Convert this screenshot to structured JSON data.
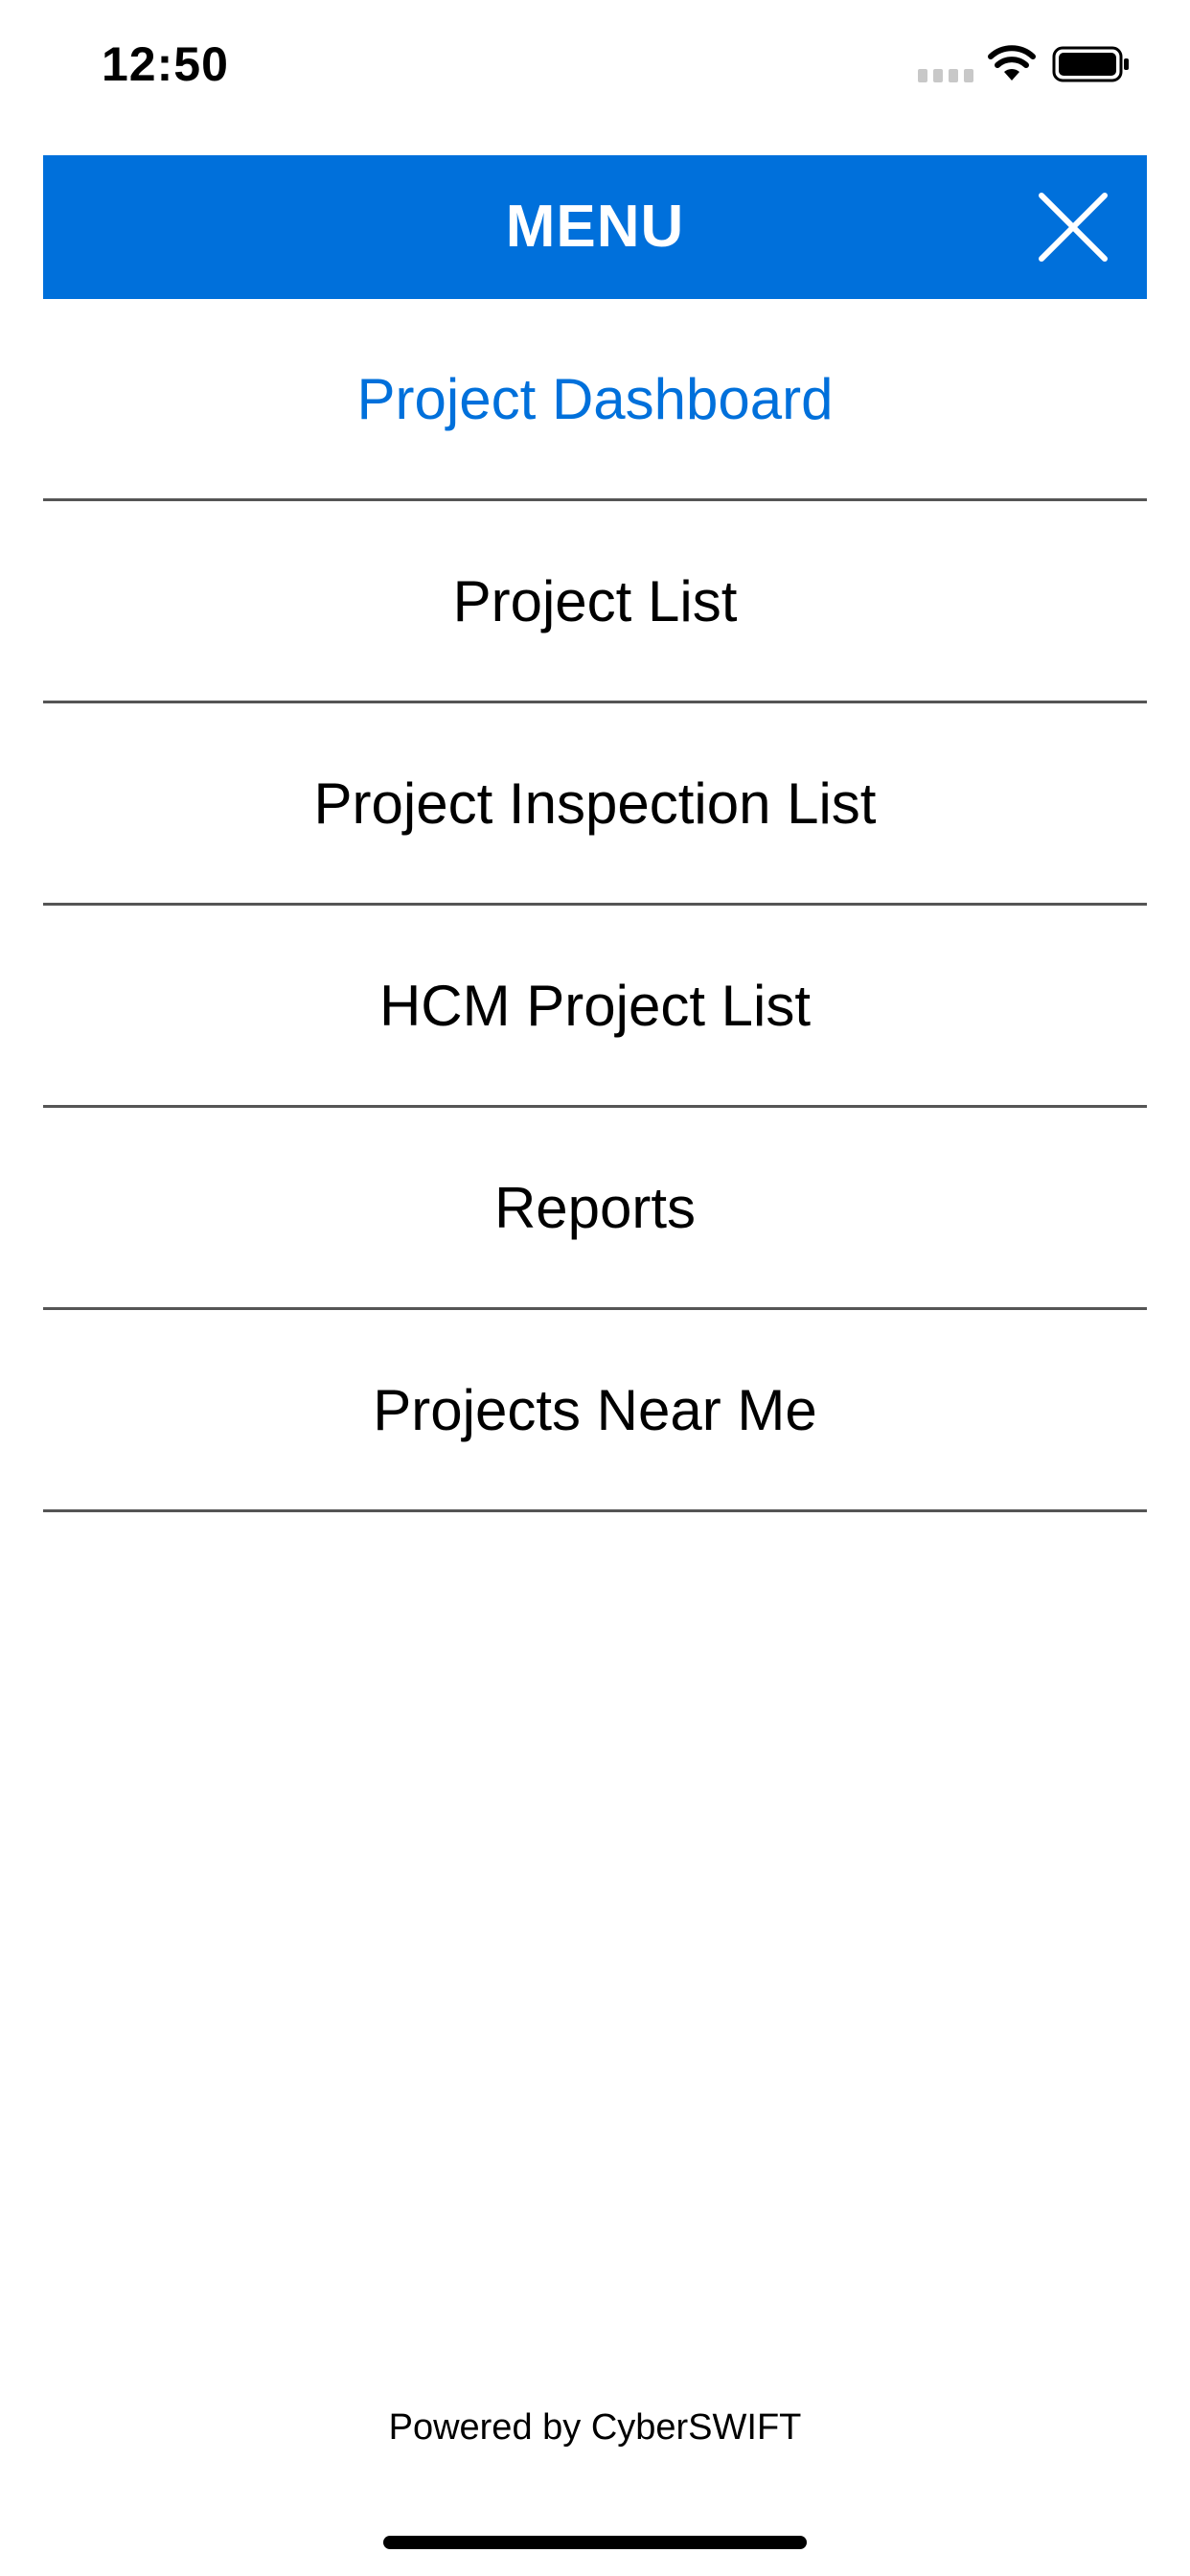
{
  "status_bar": {
    "time": "12:50",
    "icons": [
      "signal-icon",
      "wifi-icon",
      "battery-icon"
    ]
  },
  "header": {
    "title": "MENU",
    "close_icon": "close-icon",
    "background_color": "#0070db"
  },
  "menu": {
    "items": [
      {
        "label": "Project Dashboard",
        "active": true
      },
      {
        "label": "Project List",
        "active": false
      },
      {
        "label": "Project Inspection List",
        "active": false
      },
      {
        "label": "HCM Project List",
        "active": false
      },
      {
        "label": "Reports",
        "active": false
      },
      {
        "label": "Projects Near Me",
        "active": false
      }
    ],
    "active_color": "#0070db"
  },
  "footer": {
    "text": "Powered by CyberSWIFT"
  }
}
